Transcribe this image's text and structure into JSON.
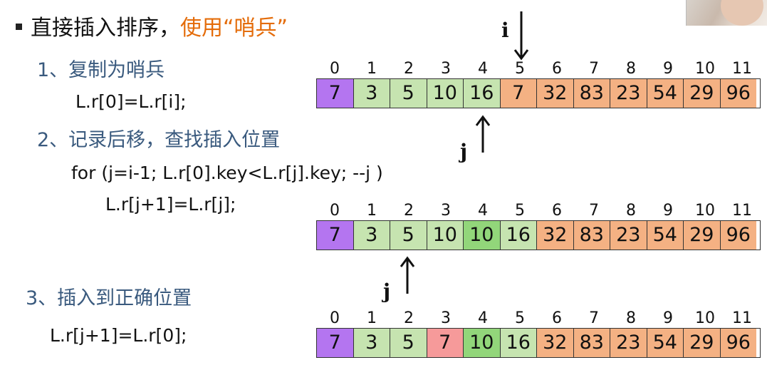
{
  "header": {
    "title_prefix": "直接插入排序，",
    "title_accent": "使用“哨兵”"
  },
  "steps": {
    "step1_label": "1、复制为哨兵",
    "step1_code": "L.r[0]=L.r[i];",
    "step2_label": "2、记录后移，查找插入位置",
    "step2_code_line1": "for (j=i-1; L.r[0].key<L.r[j].key; --j )",
    "step2_code_line2": "L.r[j+1]=L.r[j];",
    "step3_label": "3、插入到正确位置",
    "step3_code": "L.r[j+1]=L.r[0];"
  },
  "pointers": {
    "i_label": "i",
    "j_label": "j"
  },
  "indices": [
    "0",
    "1",
    "2",
    "3",
    "4",
    "5",
    "6",
    "7",
    "8",
    "9",
    "10",
    "11"
  ],
  "arrays": [
    {
      "values": [
        "7",
        "3",
        "5",
        "10",
        "16",
        "7",
        "32",
        "83",
        "23",
        "54",
        "29",
        "96"
      ],
      "colors": [
        "#B475F0",
        "#C6E4B0",
        "#C6E4B0",
        "#C6E4B0",
        "#C6E4B0",
        "#F4B183",
        "#F4B183",
        "#F4B183",
        "#F4B183",
        "#F4B183",
        "#F4B183",
        "#F4B183"
      ]
    },
    {
      "values": [
        "7",
        "3",
        "5",
        "10",
        "10",
        "16",
        "32",
        "83",
        "23",
        "54",
        "29",
        "96"
      ],
      "colors": [
        "#B475F0",
        "#C6E4B0",
        "#C6E4B0",
        "#C6E4B0",
        "#92D67A",
        "#C6E4B0",
        "#F4B183",
        "#F4B183",
        "#F4B183",
        "#F4B183",
        "#F4B183",
        "#F4B183"
      ]
    },
    {
      "values": [
        "7",
        "3",
        "5",
        "7",
        "10",
        "16",
        "32",
        "83",
        "23",
        "54",
        "29",
        "96"
      ],
      "colors": [
        "#B475F0",
        "#C6E4B0",
        "#C6E4B0",
        "#F69A9A",
        "#92D67A",
        "#C6E4B0",
        "#F4B183",
        "#F4B183",
        "#F4B183",
        "#F4B183",
        "#F4B183",
        "#F4B183"
      ]
    }
  ]
}
